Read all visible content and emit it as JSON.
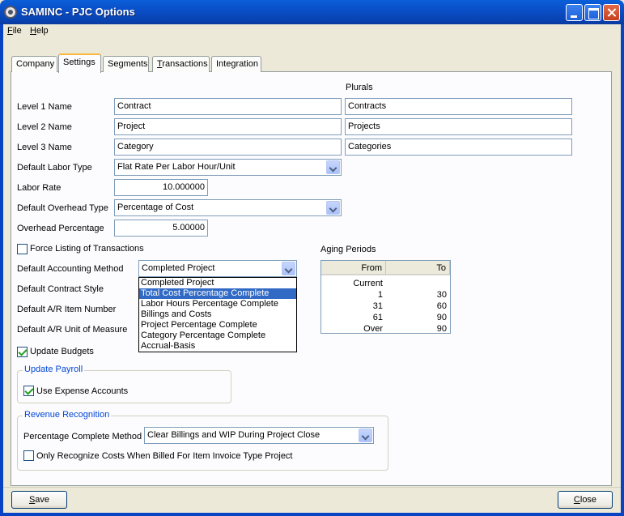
{
  "window": {
    "title": "SAMINC - PJC Options"
  },
  "menu": [
    {
      "pre": "",
      "accel": "F",
      "post": "ile"
    },
    {
      "pre": "",
      "accel": "H",
      "post": "elp"
    }
  ],
  "tabs": [
    {
      "pre": "Company",
      "accel": "",
      "post": ""
    },
    {
      "pre": "Settings",
      "accel": "",
      "post": ""
    },
    {
      "pre": "Segments",
      "accel": "",
      "post": ""
    },
    {
      "pre": "",
      "accel": "T",
      "post": "ransactions"
    },
    {
      "pre": "Integration",
      "accel": "",
      "post": ""
    }
  ],
  "levels": {
    "plurals_header": "Plurals",
    "level1": {
      "label": "Level 1 Name",
      "name": "Contract",
      "plural": "Contracts"
    },
    "level2": {
      "label": "Level 2 Name",
      "name": "Project",
      "plural": "Projects"
    },
    "level3": {
      "label": "Level 3 Name",
      "name": "Category",
      "plural": "Categories"
    }
  },
  "fields": {
    "labor_type_label": "Default Labor Type",
    "labor_type_value": "Flat Rate Per Labor Hour/Unit",
    "labor_rate_label": "Labor Rate",
    "labor_rate_value": "10.000000",
    "overhead_type_label": "Default Overhead Type",
    "overhead_type_value": "Percentage of Cost",
    "overhead_pct_label": "Overhead Percentage",
    "overhead_pct_value": "5.00000",
    "force_listing_label": "Force Listing of Transactions",
    "accounting_method_label": "Default Accounting Method",
    "accounting_method_value": "Completed Project",
    "contract_style_label": "Default Contract Style",
    "ar_item_label": "Default A/R Item Number",
    "ar_uom_label": "Default A/R Unit of Measure",
    "update_budgets_label": "Update Budgets"
  },
  "accounting_options": [
    "Completed Project",
    "Total Cost Percentage Complete",
    "Labor Hours Percentage Complete",
    "Billings and Costs",
    "Project Percentage Complete",
    "Category Percentage Complete",
    "Accrual-Basis"
  ],
  "aging": {
    "title": "Aging Periods",
    "col_from": "From",
    "col_to": "To",
    "rows": [
      {
        "from": "Current",
        "to": ""
      },
      {
        "from": "1",
        "to": "30"
      },
      {
        "from": "31",
        "to": "60"
      },
      {
        "from": "61",
        "to": "90"
      },
      {
        "from": "Over",
        "to": "90"
      }
    ]
  },
  "payroll": {
    "title": "Update Payroll",
    "use_expense_label": "Use Expense Accounts"
  },
  "revenue": {
    "title": "Revenue Recognition",
    "pct_method_label": "Percentage Complete Method",
    "pct_method_value": "Clear Billings and WIP During Project Close",
    "only_recognize_label": "Only Recognize Costs When Billed For Item Invoice Type Project"
  },
  "buttons": {
    "save": {
      "pre": "",
      "accel": "S",
      "post": "ave"
    },
    "close": {
      "pre": "",
      "accel": "C",
      "post": "lose"
    }
  }
}
